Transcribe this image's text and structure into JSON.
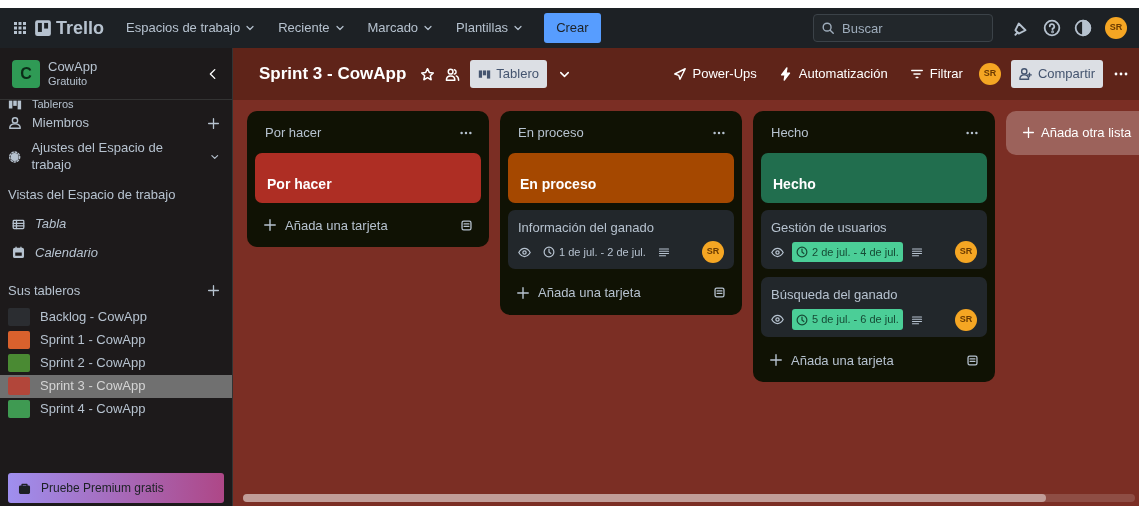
{
  "topbar": {
    "logo": "Trello",
    "menus": [
      "Espacios de trabajo",
      "Reciente",
      "Marcado",
      "Plantillas"
    ],
    "create": "Crear",
    "search": {
      "placeholder": "Buscar"
    },
    "avatar": "SR"
  },
  "sidebar": {
    "workspace": {
      "initial": "C",
      "name": "CowApp",
      "plan": "Gratuito"
    },
    "items": [
      {
        "label": "Tableros",
        "kind": "boards"
      },
      {
        "label": "Miembros",
        "kind": "members"
      },
      {
        "label": "Ajustes del Espacio de trabajo",
        "kind": "settings"
      }
    ],
    "views_title": "Vistas del Espacio de trabajo",
    "views": [
      {
        "label": "Tabla",
        "kind": "table"
      },
      {
        "label": "Calendario",
        "kind": "calendar"
      }
    ],
    "boards_title": "Sus tableros",
    "boards": [
      {
        "label": "Backlog - CowApp",
        "color": "#2b2d31",
        "selected": false
      },
      {
        "label": "Sprint 1 - CowApp",
        "color": "#d9612d",
        "selected": false
      },
      {
        "label": "Sprint 2 - CowApp",
        "color": "#4a8a33",
        "selected": false
      },
      {
        "label": "Sprint 3 - CowApp",
        "color": "#b2463a",
        "selected": true
      },
      {
        "label": "Sprint 4 - CowApp",
        "color": "#3f9a52",
        "selected": false
      }
    ],
    "premium": "Pruebe Premium gratis"
  },
  "board": {
    "title": "Sprint 3 - CowApp",
    "view": "Tablero",
    "actions": [
      {
        "label": "Power-Ups",
        "kind": "rocket"
      },
      {
        "label": "Automatización",
        "kind": "bolt"
      },
      {
        "label": "Filtrar",
        "kind": "filter"
      }
    ],
    "avatar": "SR",
    "share": "Compartir",
    "lists": [
      {
        "title": "Por hacer",
        "cover": {
          "title": "Por hacer",
          "color": "#ae2e24"
        },
        "add": "Añada una tarjeta"
      },
      {
        "title": "En proceso",
        "cover": {
          "title": "En proceso",
          "color": "#a54800"
        },
        "cards": [
          {
            "title": "Información del ganado",
            "dates": "1 de jul. - 2 de jul.",
            "complete": false,
            "avatar": "SR"
          }
        ],
        "add": "Añada una tarjeta"
      },
      {
        "title": "Hecho",
        "cover": {
          "title": "Hecho",
          "color": "#216e4e"
        },
        "cards": [
          {
            "title": "Gestión de usuarios",
            "dates": "2 de jul. - 4 de jul.",
            "complete": true,
            "avatar": "SR"
          },
          {
            "title": "Búsqueda del ganado",
            "dates": "5 de jul. - 6 de jul.",
            "complete": true,
            "avatar": "SR"
          }
        ],
        "add": "Añada una tarjeta"
      }
    ],
    "add_list": "Añada otra lista"
  }
}
